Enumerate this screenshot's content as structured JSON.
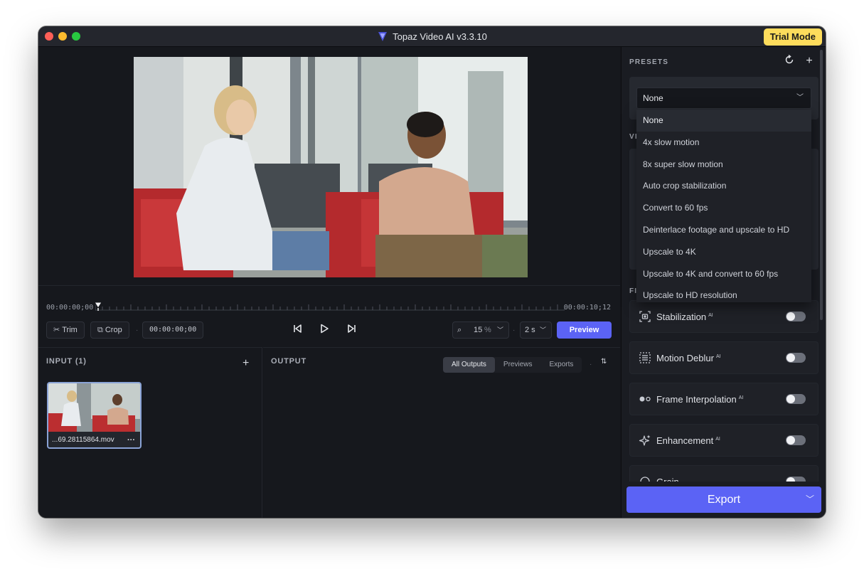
{
  "window": {
    "title": "Topaz Video AI  v3.3.10",
    "trial_badge": "Trial Mode"
  },
  "timeline": {
    "start_timecode": "00:00:00;00",
    "end_timecode": "00:00:10;12",
    "trim_label": "Trim",
    "crop_label": "Crop",
    "current_timecode": "00:00:00;00",
    "zoom_value": "15",
    "zoom_unit": "%",
    "speed_value": "2 s",
    "preview_label": "Preview"
  },
  "input_panel": {
    "title": "INPUT (1)",
    "file_name": "...69.28115864.mov"
  },
  "output_panel": {
    "title": "OUTPUT",
    "tabs": [
      "All Outputs",
      "Previews",
      "Exports"
    ],
    "active_tab": "All Outputs"
  },
  "sidebar": {
    "presets_title": "PRESETS",
    "selected_preset": "None",
    "preset_options": [
      "None",
      "4x slow motion",
      "8x super slow motion",
      "Auto crop stabilization",
      "Convert to 60 fps",
      "Deinterlace footage and upscale to HD",
      "Upscale to 4K",
      "Upscale to 4K and convert to 60 fps",
      "Upscale to HD resolution"
    ],
    "hidden_section_a": "VI",
    "hidden_section_b": "FI",
    "filters": [
      {
        "label": "Stabilization",
        "badge": "AI",
        "icon": "stabilization-icon",
        "enabled": false
      },
      {
        "label": "Motion Deblur",
        "badge": "AI",
        "icon": "motion-deblur-icon",
        "enabled": false
      },
      {
        "label": "Frame Interpolation",
        "badge": "AI",
        "icon": "frame-interpolation-icon",
        "enabled": false
      },
      {
        "label": "Enhancement",
        "badge": "AI",
        "icon": "enhancement-icon",
        "enabled": false
      },
      {
        "label": "Grain",
        "badge": "",
        "icon": "grain-icon",
        "enabled": false
      }
    ],
    "export_label": "Export"
  },
  "colors": {
    "accent": "#5b63f5",
    "trial_badge": "#fddc5c",
    "window_bg": "#15171c"
  }
}
